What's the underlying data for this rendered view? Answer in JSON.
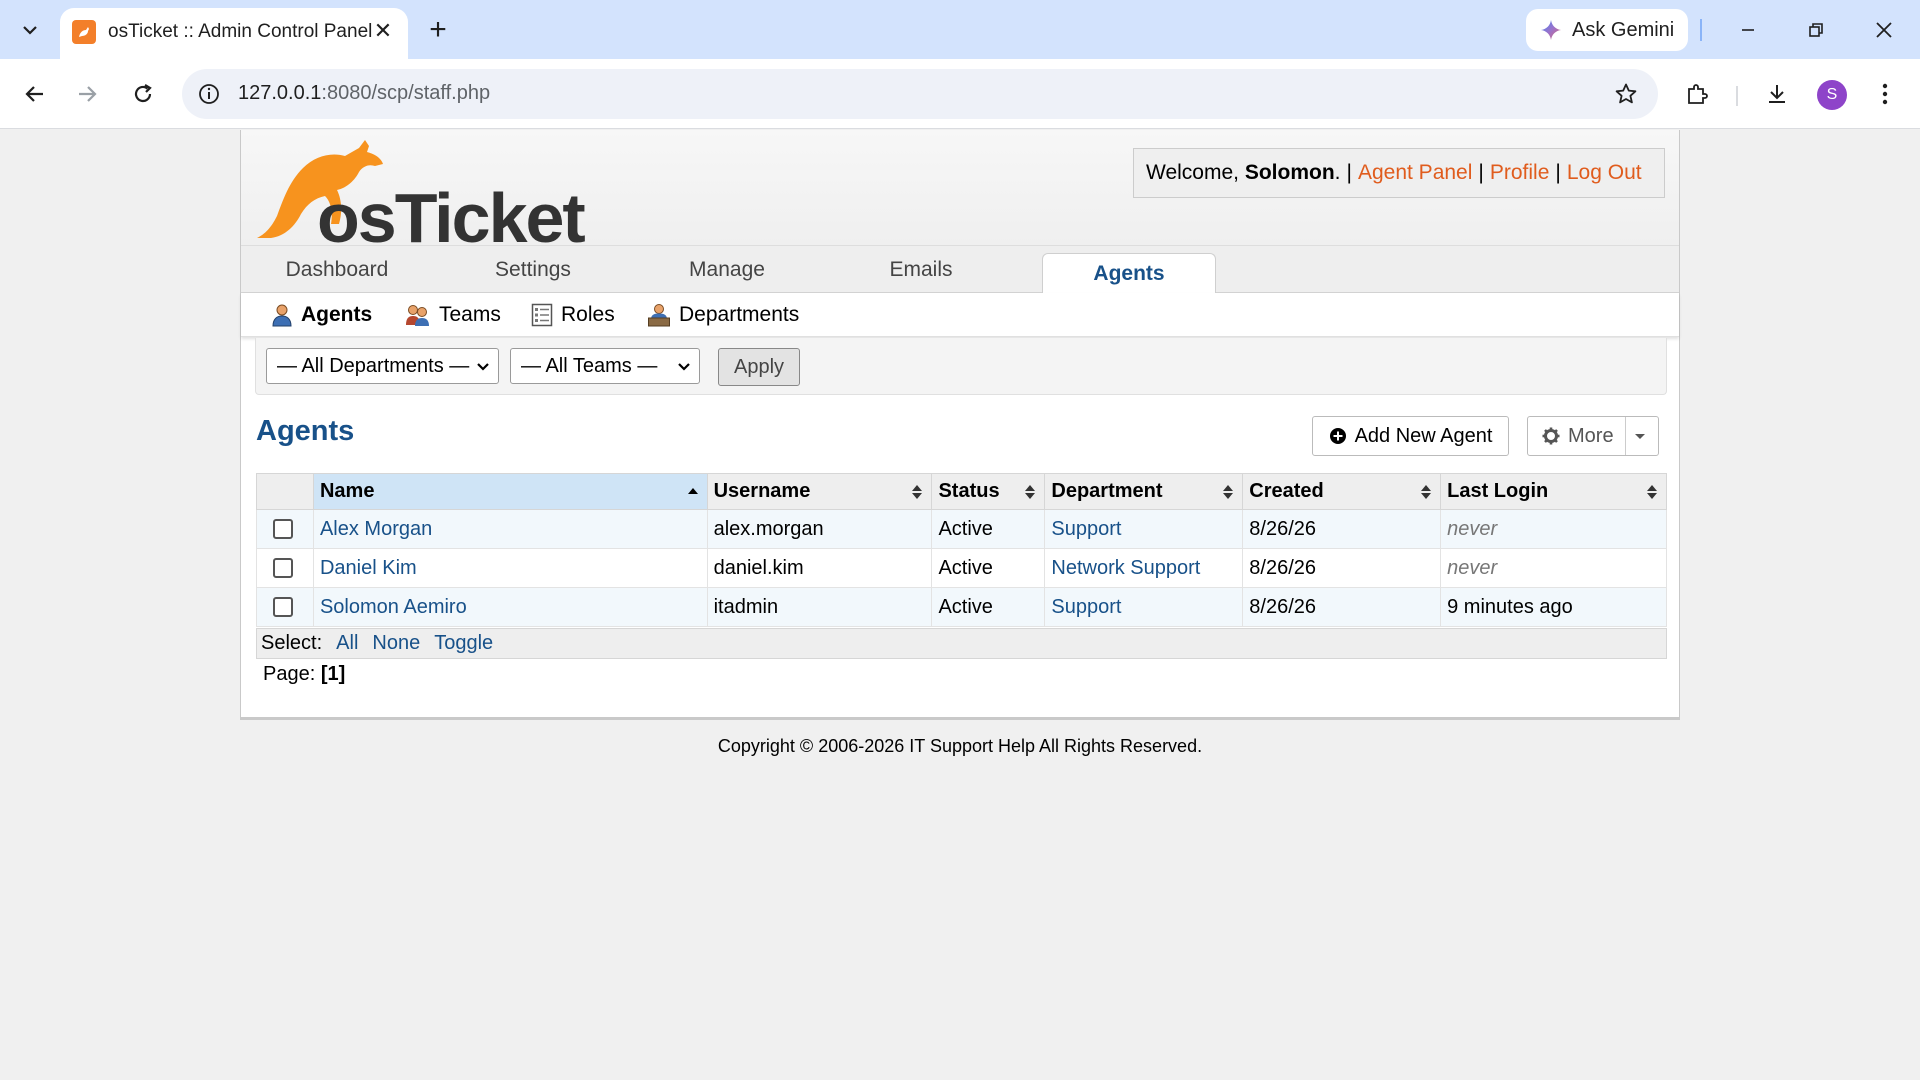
{
  "browser": {
    "tab_title": "osTicket :: Admin Control Panel",
    "url_host": "127.0.0.1",
    "url_path": ":8080/scp/staff.php",
    "gemini_label": "Ask Gemini",
    "avatar_letter": "S"
  },
  "header": {
    "logo_text": "osTicket",
    "welcome_prefix": "Welcome, ",
    "user_name": "Solomon",
    "welcome_suffix": ".",
    "links": [
      "Agent Panel",
      "Profile",
      "Log Out"
    ],
    "separator": "|"
  },
  "main_nav": {
    "items": [
      "Dashboard",
      "Settings",
      "Manage",
      "Emails",
      "Agents"
    ],
    "active": "Agents"
  },
  "sub_nav": {
    "items": [
      "Agents",
      "Teams",
      "Roles",
      "Departments"
    ],
    "active": "Agents"
  },
  "filters": {
    "department": "— All Departments —",
    "team": "— All Teams —",
    "apply_label": "Apply"
  },
  "page": {
    "title": "Agents",
    "add_label": "Add New Agent",
    "more_label": "More"
  },
  "table": {
    "columns": [
      "Name",
      "Username",
      "Status",
      "Department",
      "Created",
      "Last Login"
    ],
    "rows": [
      {
        "name": "Alex Morgan",
        "username": "alex.morgan",
        "status": "Active",
        "department": "Support",
        "created": "8/26/26",
        "last_login": "never"
      },
      {
        "name": "Daniel Kim",
        "username": "daniel.kim",
        "status": "Active",
        "department": "Network Support",
        "created": "8/26/26",
        "last_login": "never"
      },
      {
        "name": "Solomon Aemiro",
        "username": "itadmin",
        "status": "Active",
        "department": "Support",
        "created": "8/26/26",
        "last_login": "9 minutes ago"
      }
    ]
  },
  "select_bar": {
    "label": "Select:",
    "options": [
      "All",
      "None",
      "Toggle"
    ]
  },
  "pager": {
    "label": "Page:",
    "current": "[1]"
  },
  "footer": {
    "copyright": "Copyright © 2006-2026 IT Support Help All Rights Reserved."
  },
  "colors": {
    "brand_orange": "#e05c1d",
    "link_blue": "#185189",
    "tabbar": "#d3e3fd"
  }
}
